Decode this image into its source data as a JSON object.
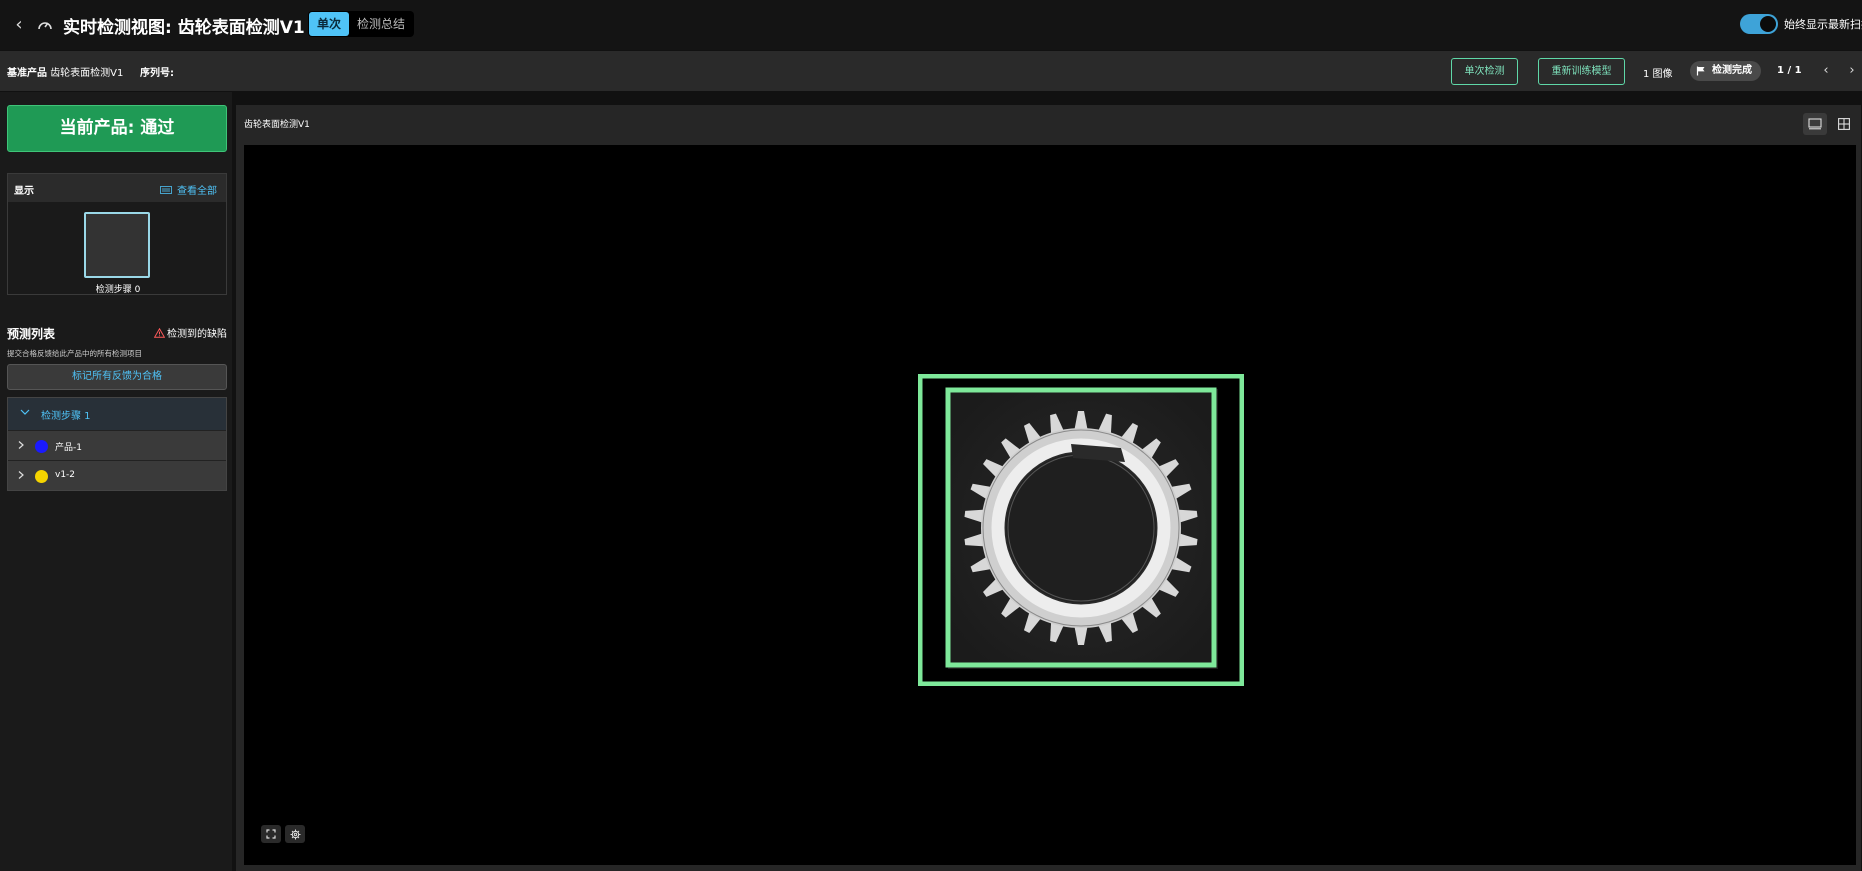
{
  "header": {
    "title": "实时检测视图: 齿轮表面检测V1",
    "view_tabs": [
      {
        "label": "单次",
        "active": true
      },
      {
        "label": "检测总结",
        "active": false
      }
    ],
    "latest_scan_label": "始终显示最新扫描",
    "latest_scan_on": true
  },
  "subbar": {
    "product_label": "基准产品",
    "product_value": "齿轮表面检测V1",
    "serial_label": "序列号:",
    "single_inspect_label": "单次检测",
    "retrain_label": "重新训练模型",
    "image_count": "1 图像",
    "status": "检测完成",
    "pager": "1 / 1"
  },
  "left": {
    "result_banner": "当前产品: 通过",
    "display_title": "显示",
    "view_all": "查看全部",
    "thumb_label": "检测步骤 0",
    "pred_title": "预测列表",
    "defect_label": "检测到的缺陷",
    "pred_hint": "提交合格反馈给此产品中的所有检测项目",
    "mark_all_label": "标记所有反馈为合格",
    "step_group_label": "检测步骤 1",
    "items": [
      {
        "label": "产品-1",
        "color": "#1a1aff"
      },
      {
        "label": "v1-2",
        "color": "#f5d400"
      }
    ]
  },
  "viewer": {
    "title": "齿轮表面检测V1",
    "box_color": "#7ee89a"
  },
  "colors": {
    "accent": "#4fc3f7",
    "pass": "#1f9a55",
    "outline_button": "#5fd8a8"
  }
}
